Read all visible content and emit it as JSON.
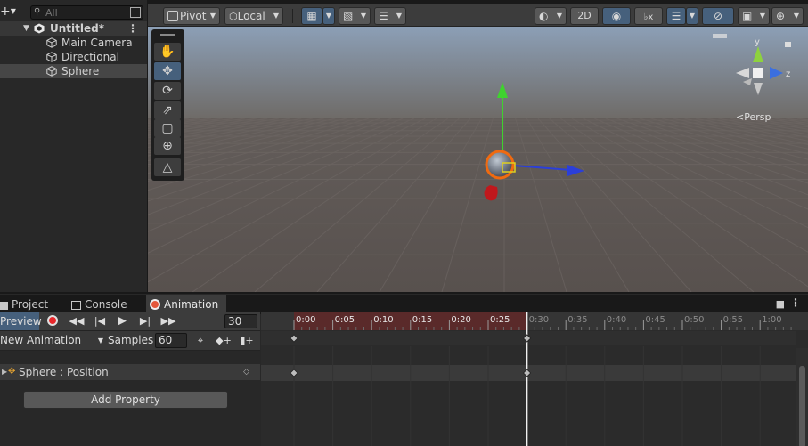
{
  "hierarchy": {
    "add_label": "+",
    "search_placeholder": "All",
    "scene_name": "Untitled*",
    "items": [
      {
        "label": "Main Camera"
      },
      {
        "label": "Directional Light"
      },
      {
        "label": "Sphere"
      }
    ]
  },
  "scene_toolbar": {
    "pivot_label": "Pivot",
    "local_label": "Local",
    "mode_2d_label": "2D"
  },
  "scene_view": {
    "persp_label": "<Persp",
    "gizmo_y": "y",
    "gizmo_z": "z",
    "colors": {
      "sky_top": "#8c9fb6",
      "horizon": "#6e6a66",
      "ground": "#58514e",
      "axis_x": "#2b3fd9",
      "axis_y": "#3fd22e",
      "axis_z": "#d22e2e",
      "selection": "#f06a10"
    }
  },
  "bottom_tabs": [
    {
      "label": "Project",
      "icon": "folder-icon"
    },
    {
      "label": "Console",
      "icon": "console-icon"
    },
    {
      "label": "Animation",
      "icon": "animation-icon"
    }
  ],
  "animation": {
    "preview_label": "Preview",
    "current_frame": "30",
    "clip_name": "New Animation",
    "samples_label": "Samples",
    "samples_value": "60",
    "property_label": "Sphere : Position",
    "add_property_label": "Add Property",
    "ruler_ticks": [
      "0:00",
      "0:05",
      "0:10",
      "0:15",
      "0:20",
      "0:25",
      "0:30",
      "0:35",
      "0:40",
      "0:45",
      "0:50",
      "0:55",
      "1:00"
    ],
    "highlight_range_end_tick": "0:30",
    "playhead_tick": "0:30",
    "keyframes_at": [
      "0:00",
      "0:30"
    ]
  }
}
